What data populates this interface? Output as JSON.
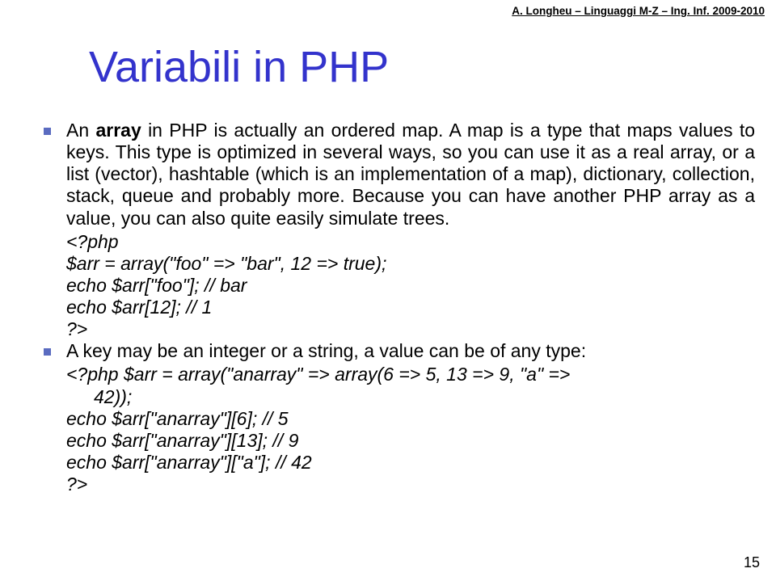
{
  "header": "A. Longheu – Linguaggi M-Z – Ing. Inf. 2009-2010",
  "title": "Variabili in PHP",
  "bullet1_start": "An ",
  "bullet1_bold": "array",
  "bullet1_rest": " in PHP is actually an ordered map. A map is a type that maps values to keys. This type is optimized in several ways, so you can use it as a real array, or a list (vector), hashtable (which is an implementation of a map), dictionary, collection, stack, queue and probably more. Because you can have another PHP array as a value, you can also quite easily simulate trees.",
  "code1": {
    "l1": "<?php",
    "l2": "$arr = array(\"foo\" => \"bar\", 12 => true);",
    "l3": "echo $arr[\"foo\"]; // bar",
    "l4": "echo $arr[12]; // 1",
    "l5": "?>"
  },
  "bullet2": "A key may be an integer or a string, a value can be of any type:",
  "code2": {
    "l1a": "<?php $arr = array(\"anarray\" => array(6 => 5, 13 => 9, \"a\" =>",
    "l1b": "42));",
    "l2": "echo $arr[\"anarray\"][6]; // 5",
    "l3": "echo $arr[\"anarray\"][13]; // 9",
    "l4": "echo $arr[\"anarray\"][\"a\"]; // 42",
    "l5": "?>"
  },
  "pagenum": "15"
}
